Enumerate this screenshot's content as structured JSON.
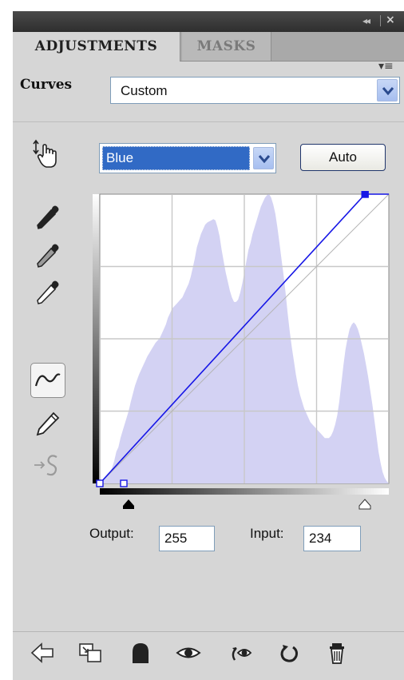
{
  "tabs": [
    {
      "label": "ADJUSTMENTS",
      "active": true
    },
    {
      "label": "MASKS",
      "active": false
    }
  ],
  "titlebar": {
    "collapse_glyph": "◂◂",
    "close_glyph": "×",
    "menu_glyph": "▾≡"
  },
  "preset": {
    "label": "Curves",
    "value": "Custom"
  },
  "channel": {
    "value": "Blue"
  },
  "auto_button": {
    "label": "Auto"
  },
  "output": {
    "label": "Output:",
    "value": "255"
  },
  "input": {
    "label": "Input:",
    "value": "234"
  },
  "colors": {
    "histogram_fill": "#d3d2f3",
    "curve_line": "#1717e6",
    "selection_blue": "#316ac5",
    "panel_bg": "#d6d6d6"
  },
  "curve": {
    "points": [
      [
        0,
        0
      ],
      [
        234,
        255
      ],
      [
        255,
        255
      ]
    ],
    "selected_point": [
      234,
      255
    ],
    "black_input": 0,
    "white_input": 234
  },
  "histogram": [
    0,
    2,
    4,
    5,
    8,
    10,
    14,
    20,
    28,
    32,
    40,
    46,
    52,
    58,
    64,
    72,
    79,
    86,
    91,
    96,
    100,
    104,
    108,
    112,
    115,
    118,
    121,
    124,
    126,
    128,
    132,
    136,
    140,
    146,
    150,
    154,
    156,
    158,
    160,
    162,
    164,
    168,
    172,
    176,
    182,
    190,
    198,
    208,
    214,
    220,
    224,
    228,
    230,
    231,
    232,
    233,
    232,
    226,
    218,
    206,
    196,
    186,
    178,
    170,
    164,
    160,
    160,
    162,
    168,
    176,
    186,
    196,
    206,
    212,
    220,
    226,
    232,
    238,
    244,
    248,
    252,
    254,
    255,
    252,
    246,
    238,
    226,
    212,
    198,
    184,
    168,
    150,
    134,
    120,
    108,
    96,
    86,
    78,
    72,
    66,
    62,
    58,
    54,
    52,
    50,
    48,
    46,
    44,
    42,
    40,
    40,
    40,
    42,
    46,
    52,
    60,
    72,
    88,
    104,
    118,
    128,
    136,
    140,
    142,
    140,
    136,
    130,
    122,
    114,
    104,
    94,
    82,
    70,
    56,
    42,
    28,
    18,
    10,
    5,
    2,
    0
  ],
  "footer_icons": [
    "back-arrow-icon",
    "clip-to-layer-icon",
    "layer-mask-icon",
    "eye-icon",
    "view-previous-icon",
    "reset-icon",
    "trash-icon"
  ]
}
